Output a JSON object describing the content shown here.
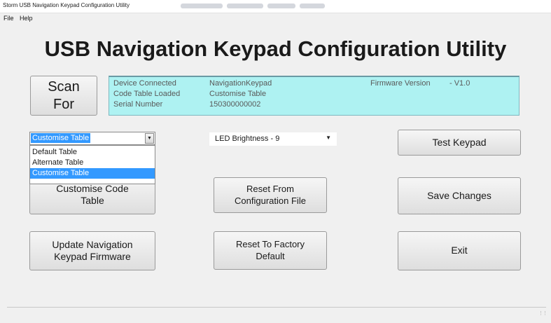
{
  "window": {
    "title": "Storm USB Navigation Keypad Configuration Utility"
  },
  "menu": {
    "file": "File",
    "help": "Help"
  },
  "app_title": "USB Navigation Keypad Configuration Utility",
  "scan_button": {
    "label": "Scan\nFor"
  },
  "info": {
    "device_label": "Device Connected",
    "device_value": "NavigationKeypad",
    "firmware_label": "Firmware Version",
    "firmware_value": "-  V1.0",
    "code_table_label": "Code Table Loaded",
    "code_table_value": "Customise Table",
    "serial_label": "Serial Number",
    "serial_value": "150300000002"
  },
  "table_select": {
    "selected": "Customise Table",
    "options": [
      "Default Table",
      "Alternate Table",
      "Customise Table"
    ],
    "highlighted_index": 2
  },
  "brightness_select": {
    "selected": "LED Brightness - 9"
  },
  "buttons": {
    "test_keypad": "Test Keypad",
    "customise_code_table": "Customise Code\nTable",
    "reset_from_config": "Reset From\nConfiguration File",
    "save_changes": "Save Changes",
    "update_firmware": "Update Navigation\nKeypad Firmware",
    "reset_factory": "Reset To Factory\nDefault",
    "exit": "Exit"
  },
  "colors": {
    "info_panel_bg": "#aef2f2",
    "selection": "#3399ff",
    "window_bg": "#f0f0f0"
  },
  "icons": {
    "dropdown_arrow": "chevron-down-icon",
    "resize_grip": "resize-grip-icon"
  }
}
